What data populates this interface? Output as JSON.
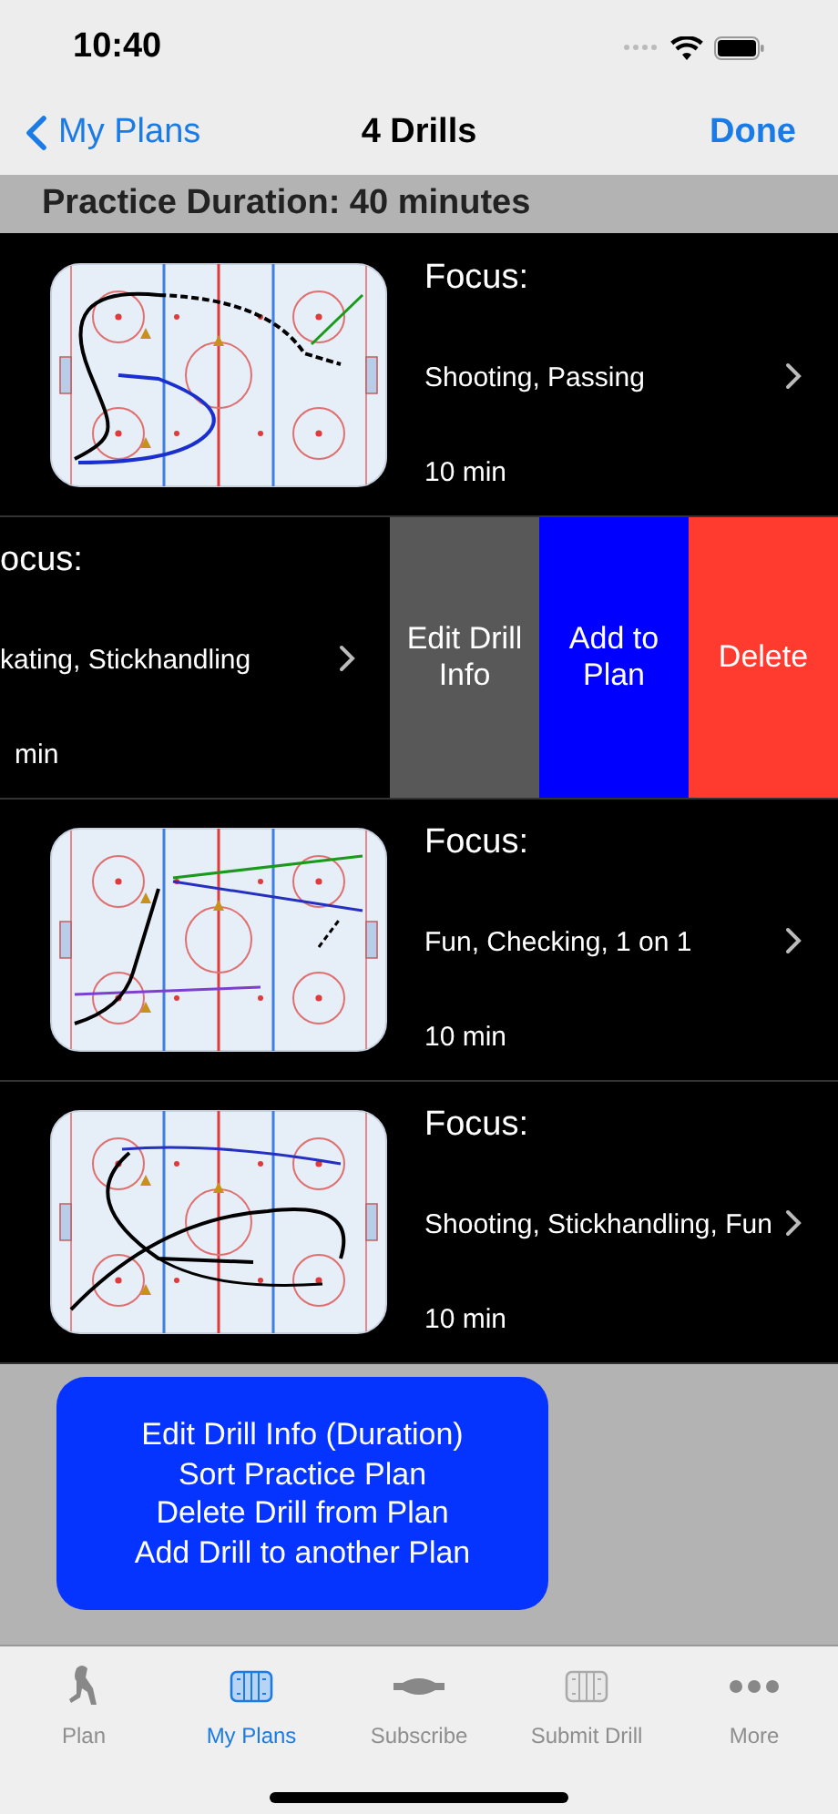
{
  "status_bar": {
    "time": "10:40"
  },
  "nav": {
    "back": "My Plans",
    "title": "4 Drills",
    "action": "Done"
  },
  "duration": "Practice Duration: 40 minutes",
  "drills": [
    {
      "swiped": false,
      "focus_label": "Focus:",
      "focus": "Shooting, Passing",
      "time": "10 min"
    },
    {
      "swiped": true,
      "focus_label": "ocus:",
      "focus": "kating, Stickhandling",
      "time": "min",
      "actions": [
        {
          "kind": "edit",
          "label": "Edit Drill Info"
        },
        {
          "kind": "add",
          "label": "Add to Plan"
        },
        {
          "kind": "delete",
          "label": "Delete"
        }
      ]
    },
    {
      "swiped": false,
      "focus_label": "Focus:",
      "focus": "Fun, Checking, 1 on 1",
      "time": "10 min"
    },
    {
      "swiped": false,
      "focus_label": "Focus:",
      "focus": "Shooting, Stickhandling, Fun",
      "time": "10 min"
    }
  ],
  "help_lines": [
    "Edit Drill Info (Duration)",
    "Sort Practice Plan",
    "Delete Drill from Plan",
    "Add Drill to another Plan"
  ],
  "tabs": [
    {
      "kind": "skater",
      "label": "Plan",
      "selected": false
    },
    {
      "kind": "rink",
      "label": "My Plans",
      "selected": true
    },
    {
      "kind": "puck",
      "label": "Subscribe",
      "selected": false
    },
    {
      "kind": "rink",
      "label": "Submit Drill",
      "selected": false
    },
    {
      "kind": "dots",
      "label": "More",
      "selected": false
    }
  ]
}
